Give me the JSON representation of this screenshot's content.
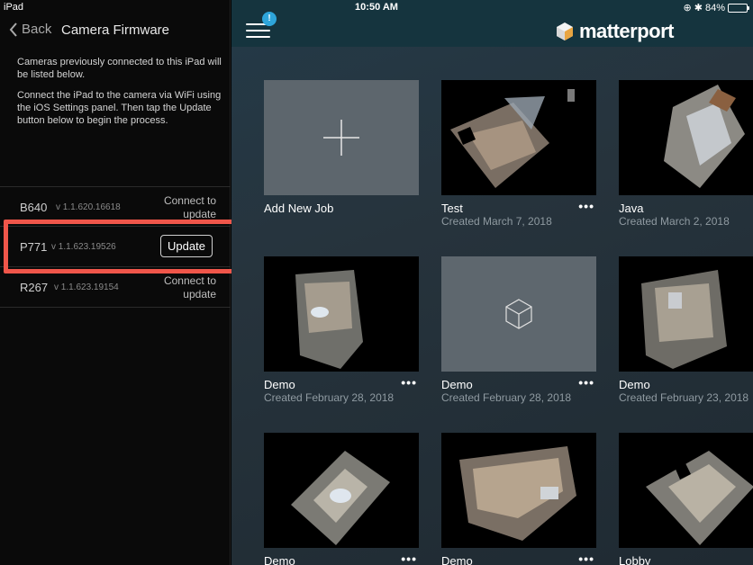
{
  "status_bar": {
    "device": "iPad",
    "time": "10:50 AM",
    "battery": "84%",
    "battery_level": 0.84
  },
  "sidebar": {
    "back_label": "Back",
    "title": "Camera Firmware",
    "description_1": "Cameras previously connected to this iPad will be listed below.",
    "description_2": "Connect the iPad to the camera via WiFi using the iOS Settings panel. Then tap the Update button below to begin the process.",
    "cameras": [
      {
        "name": "B640",
        "version": "v 1.1.620.16618",
        "status": "Connect to update"
      },
      {
        "name": "P771",
        "version": "v 1.1.623.19526",
        "action": "Update"
      },
      {
        "name": "R267",
        "version": "v 1.1.623.19154",
        "status": "Connect to update"
      }
    ]
  },
  "header": {
    "badge": "!",
    "brand": "matterport"
  },
  "jobs": [
    {
      "title": "Add New Job",
      "kind": "add"
    },
    {
      "title": "Test",
      "date": "Created March 7, 2018",
      "more": "•••"
    },
    {
      "title": "Java",
      "date": "Created March 2, 2018",
      "more": "•••"
    },
    {
      "title": "Demo",
      "date": "Created February 28, 2018",
      "more": "•••"
    },
    {
      "title": "Demo",
      "date": "Created February 28, 2018",
      "more": "•••",
      "kind": "empty"
    },
    {
      "title": "Demo",
      "date": "Created February 23, 2018",
      "more": "•••"
    },
    {
      "title": "Demo",
      "more": "•••"
    },
    {
      "title": "Demo",
      "more": "•••"
    },
    {
      "title": "Lobby"
    }
  ],
  "colors": {
    "highlight": "#f0564a",
    "badge": "#2ea5da",
    "topbar": "#15343e"
  }
}
